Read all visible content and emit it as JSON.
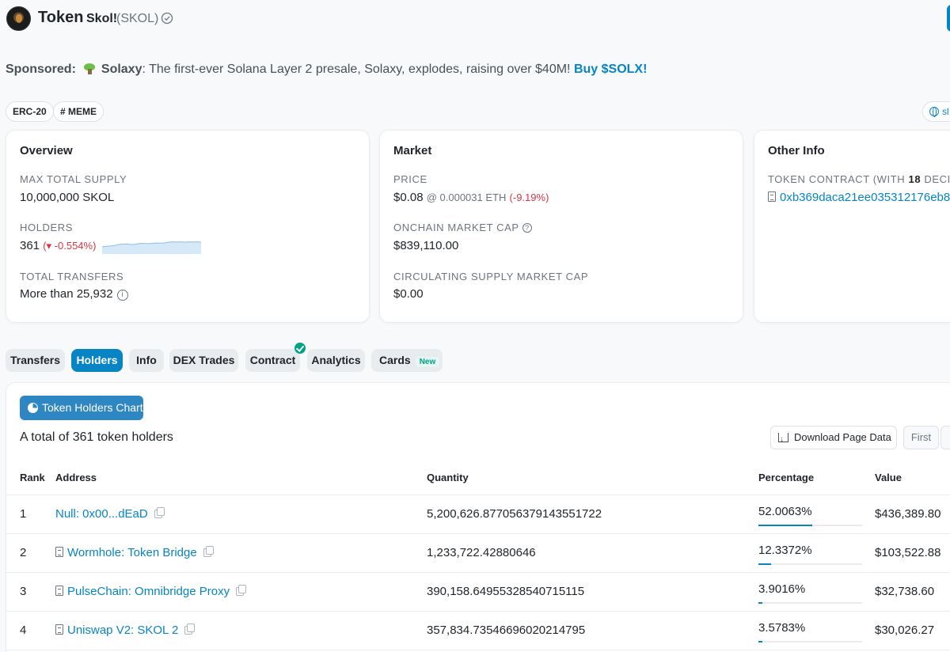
{
  "header": {
    "title": "Token",
    "token_name": "Skol!",
    "token_symbol": "(SKOL)"
  },
  "sponsored": {
    "label": "Sponsored:",
    "brand": "Solaxy",
    "text": ": The first-ever Solana Layer 2 presale, Solaxy, explodes, raising over $40M!",
    "cta": "Buy $SOLX!"
  },
  "badges": {
    "erc": "ERC-20",
    "meme": "# MEME",
    "site": "sl"
  },
  "overview": {
    "title": "Overview",
    "max_supply_label": "MAX TOTAL SUPPLY",
    "max_supply_value": "10,000,000 SKOL",
    "holders_label": "HOLDERS",
    "holders_value": "361",
    "holders_change": "(▾ -0.554%)",
    "transfers_label": "TOTAL TRANSFERS",
    "transfers_value": "More than 25,932"
  },
  "market": {
    "title": "Market",
    "price_label": "PRICE",
    "price_value": "$0.08",
    "price_eth": "@ 0.000031 ETH",
    "price_change": "(-9.19%)",
    "mcap_label": "ONCHAIN MARKET CAP",
    "mcap_value": "$839,110.00",
    "circ_label": "CIRCULATING SUPPLY MARKET CAP",
    "circ_value": "$0.00"
  },
  "other_info": {
    "title": "Other Info",
    "contract_label_prefix": "TOKEN CONTRACT (WITH",
    "contract_decimals": "18",
    "contract_label_suffix": "DECIMAL",
    "contract_address": "0xb369daca21ee035312176eb8"
  },
  "tabs": {
    "transfers": "Transfers",
    "holders": "Holders",
    "info": "Info",
    "dex": "DEX Trades",
    "contract": "Contract",
    "analytics": "Analytics",
    "cards": "Cards",
    "cards_badge": "New"
  },
  "holders_panel": {
    "chart_button": "Token Holders Chart",
    "total_text": "A total of 361 token holders",
    "download_button": "Download Page Data",
    "first_button": "First",
    "columns": [
      "Rank",
      "Address",
      "Quantity",
      "Percentage",
      "Value"
    ],
    "rows": [
      {
        "rank": "1",
        "address": "Null: 0x00...dEaD",
        "contract": false,
        "quantity": "5,200,626.877056379143551722",
        "percentage": "52.0063%",
        "pct_value": 52.0063,
        "value": "$436,389.80"
      },
      {
        "rank": "2",
        "address": "Wormhole: Token Bridge",
        "contract": true,
        "quantity": "1,233,722.42880646",
        "percentage": "12.3372%",
        "pct_value": 12.3372,
        "value": "$103,522.88"
      },
      {
        "rank": "3",
        "address": "PulseChain: Omnibridge Proxy",
        "contract": true,
        "quantity": "390,158.649553285407151​15",
        "percentage": "3.9016%",
        "pct_value": 3.9016,
        "value": "$32,738.60"
      },
      {
        "rank": "4",
        "address": "Uniswap V2: SKOL 2",
        "contract": true,
        "quantity": "357,834.735466960202147​95",
        "percentage": "3.5783%",
        "pct_value": 3.5783,
        "value": "$30,026.27"
      }
    ]
  },
  "holders_sparkline": [
    0.62,
    0.6,
    0.58,
    0.55,
    0.5,
    0.48,
    0.47,
    0.5,
    0.49,
    0.45,
    0.44,
    0.46,
    0.44,
    0.42,
    0.43,
    0.42,
    0.38,
    0.36,
    0.37,
    0.36,
    0.38,
    0.36,
    0.37,
    0.36,
    0.38
  ],
  "colors": {
    "accent": "#0784c3",
    "negative": "#dc3545",
    "success": "#00a186"
  }
}
